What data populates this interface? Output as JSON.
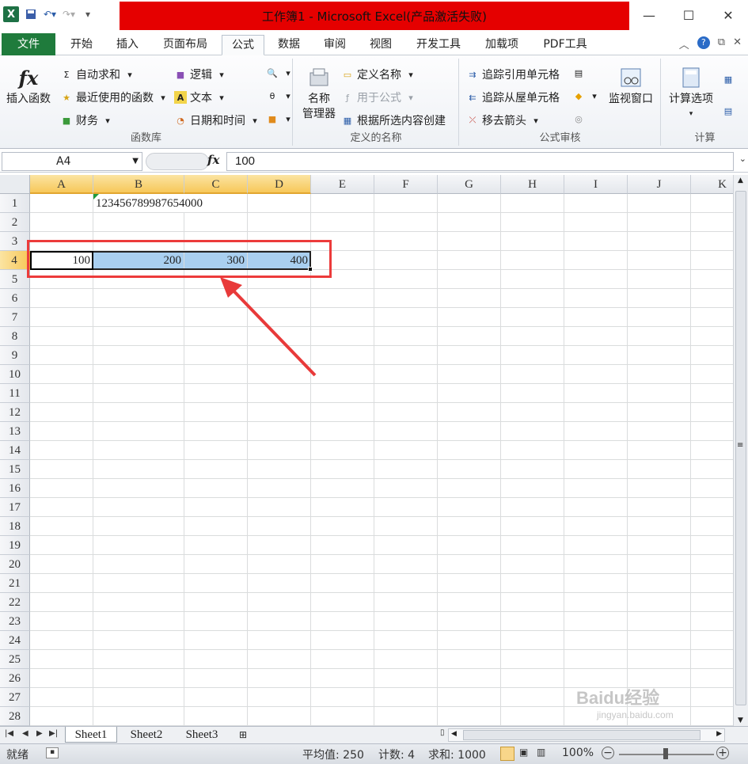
{
  "title": "工作簿1 - Microsoft Excel(产品激活失败)",
  "window_controls": {
    "minimize": "—",
    "maximize": "☐",
    "close": "✕"
  },
  "tabs": [
    "文件",
    "开始",
    "插入",
    "页面布局",
    "公式",
    "数据",
    "审阅",
    "视图",
    "开发工具",
    "加载项",
    "PDF工具"
  ],
  "active_tab": "公式",
  "ribbon": {
    "library": {
      "insert_function": "插入函数",
      "autosum": "自动求和",
      "recent": "最近使用的函数",
      "financial": "财务",
      "logical": "逻辑",
      "text": "文本",
      "datetime": "日期和时间",
      "label": "函数库"
    },
    "names": {
      "name_manager_1": "名称",
      "name_manager_2": "管理器",
      "define_name": "定义名称",
      "use_in_formula": "用于公式",
      "create_from_selection": "根据所选内容创建",
      "label": "定义的名称"
    },
    "audit": {
      "trace_precedents": "追踪引用单元格",
      "trace_dependents": "追踪从屋单元格",
      "remove_arrows": "移去箭头",
      "watch_window": "监视窗口",
      "label": "公式审核"
    },
    "calc": {
      "options": "计算选项",
      "label": "计算"
    }
  },
  "formula_bar": {
    "name_box": "A4",
    "fx": "fx",
    "value": "100"
  },
  "columns": [
    "A",
    "B",
    "C",
    "D",
    "E",
    "F",
    "G",
    "H",
    "I",
    "J",
    "K"
  ],
  "rows": [
    "1",
    "2",
    "3",
    "4",
    "5",
    "6",
    "7",
    "8",
    "9",
    "10",
    "11",
    "12",
    "13",
    "14",
    "15",
    "16",
    "17",
    "18",
    "19",
    "20",
    "21",
    "22",
    "23",
    "24",
    "25",
    "26",
    "27",
    "28"
  ],
  "cells": {
    "B1": "123456789987654000",
    "A4": "100",
    "B4": "200",
    "C4": "300",
    "D4": "400"
  },
  "sheets": [
    "Sheet1",
    "Sheet2",
    "Sheet3"
  ],
  "active_sheet": "Sheet1",
  "status": {
    "ready": "就绪",
    "average": "平均值: 250",
    "count": "计数: 4",
    "sum": "求和: 1000",
    "zoom": "100%"
  },
  "watermark": {
    "brand": "Baidu经验",
    "url": "jingyan.baidu.com"
  }
}
